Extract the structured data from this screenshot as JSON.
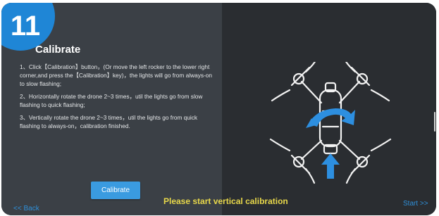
{
  "step": {
    "number": "11"
  },
  "title": "Calibrate",
  "instructions": [
    "1、Click【Calibration】button，(Or move the left rocker to the lower right corner,and press the【Calibration】key)，the lights will go from always-on to slow flashing;",
    "2、Horizontally rotate the drone 2~3 times，util the lights go from slow flashing to quick flashing;",
    "3、Vertically rotate the drone 2~3 times，util the lights go from quick flashing to always-on，calibration finished."
  ],
  "buttons": {
    "calibrate": "Calibrate"
  },
  "nav": {
    "back": "<< Back",
    "start": "Start >>"
  },
  "status": "Please start vertical calibration",
  "icons": {
    "step_badge": "step-number-badge",
    "drone": "drone-top-view-icon",
    "rotate": "rotate-arrow-icon",
    "up": "up-arrow-icon"
  },
  "colors": {
    "accent_blue": "#1f86d6",
    "button_blue": "#3a9be0",
    "status_yellow": "#e8d84a",
    "link_blue": "#2f8fd8"
  }
}
